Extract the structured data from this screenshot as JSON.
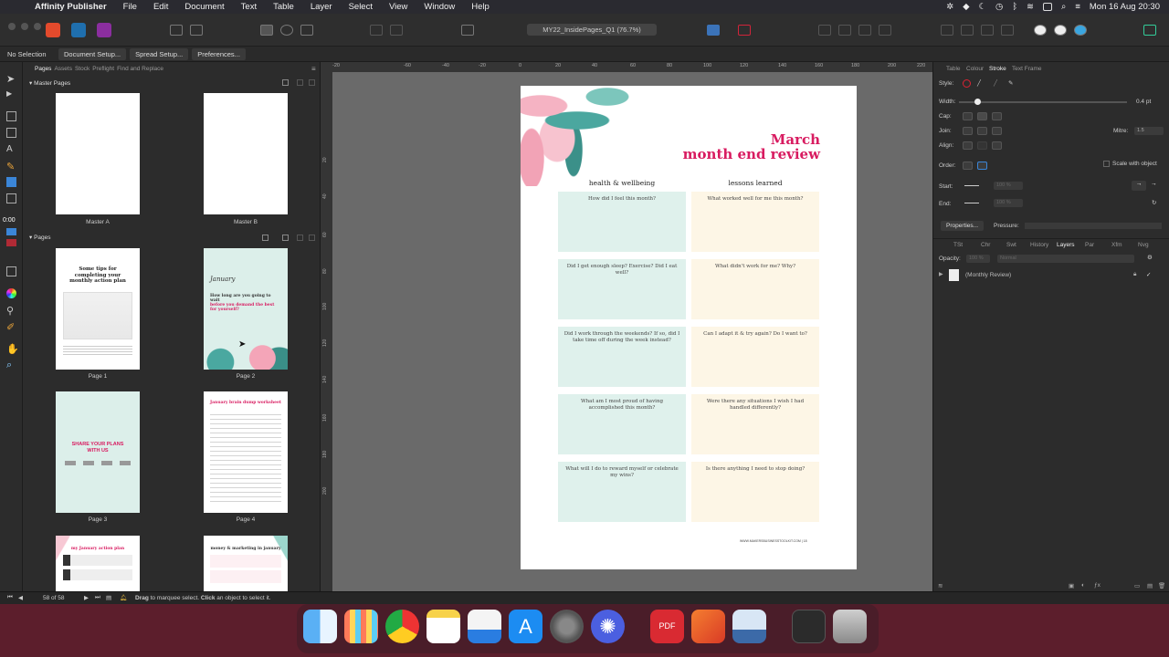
{
  "menubar": {
    "app_name": "Affinity Publisher",
    "items": [
      "File",
      "Edit",
      "Document",
      "Text",
      "Table",
      "Layer",
      "Select",
      "View",
      "Window",
      "Help"
    ],
    "clock": "Mon 16 Aug  20:30"
  },
  "toolbar": {
    "document_name": "MY22_InsidePages_Q1 (76.7%)"
  },
  "contextbar": {
    "selection": "No Selection",
    "document_setup": "Document Setup...",
    "spread_setup": "Spread Setup...",
    "preferences": "Preferences..."
  },
  "tools": {
    "timer": "0:00"
  },
  "pages_panel": {
    "tabs": [
      "Pages",
      "Assets",
      "Stock",
      "Preflight",
      "Find and Replace"
    ],
    "master_header": "Master Pages",
    "pages_header": "Pages",
    "masters": [
      "Master A",
      "Master B"
    ],
    "pages": [
      {
        "label": "Page 1",
        "title": "Some tips for completing your monthly action plan"
      },
      {
        "label": "Page 2",
        "script": "January",
        "question": "How long are you going to wait",
        "question_pink": "before you demand the best for yourself?"
      },
      {
        "label": "Page 3",
        "title": "SHARE YOUR PLANS WITH US"
      },
      {
        "label": "Page 4",
        "title": "January brain dump worksheet"
      },
      {
        "label": "",
        "title": "my January action plan"
      },
      {
        "label": "",
        "title": "money & marketing in january"
      }
    ]
  },
  "ruler": {
    "top": [
      "-20",
      "-40",
      "-60",
      "-40",
      "-20",
      "0",
      "20",
      "40",
      "60",
      "80",
      "100",
      "120",
      "140",
      "160",
      "180",
      "200",
      "220"
    ],
    "left": [
      "20",
      "40",
      "60",
      "80",
      "100",
      "120",
      "140",
      "160",
      "180",
      "200"
    ]
  },
  "page": {
    "title_line1": "March",
    "title_line2": "month end review",
    "col_left": "health & wellbeing",
    "col_right": "lessons learned",
    "left_boxes": [
      "How did I feel this month?",
      "Did I get enough sleep? Exercise? Did I eat well?",
      "Did I work through the weekends? If so, did I take time off during the week instead?",
      "What am I most proud of having accomplished this month?",
      "What will I do to reward myself or celebrate my wins?"
    ],
    "right_boxes": [
      "What worked well for me this month?",
      "What didn't work for me? Why?",
      "Can I adapt it & try again? Do I want to?",
      "Were there any situations I wish I had handled differently?",
      "Is there anything I need to stop doing?"
    ],
    "footer": "WWW.MAKERSBUSINESSTOOLKIT.COM | 18"
  },
  "right_panel": {
    "top_tabs": [
      "Table",
      "Colour",
      "Stroke",
      "Text Frame"
    ],
    "style_label": "Style:",
    "width_label": "Width:",
    "width_value": "0.4 pt",
    "cap_label": "Cap:",
    "join_label": "Join:",
    "align_label": "Align:",
    "mitre_label": "Mitre:",
    "mitre_value": "1.5",
    "order_label": "Order:",
    "scale_label": "Scale with object",
    "start_label": "Start:",
    "end_label": "End:",
    "start_pct": "100 %",
    "end_pct": "100 %",
    "properties_button": "Properties...",
    "pressure_label": "Pressure:",
    "lower_tabs": [
      "TSt",
      "Chr",
      "Swt",
      "History",
      "Layers",
      "Par",
      "Xfm",
      "Nvg"
    ],
    "opacity_label": "Opacity:",
    "opacity_value": "100 %",
    "blend_mode": "Normal",
    "layer_name": "(Monthly Review)"
  },
  "statusbar": {
    "page_count": "58 of 58",
    "hint_drag": "Drag",
    "hint_mid": " to marquee select. ",
    "hint_click": "Click",
    "hint_end": " an object to select it."
  },
  "dock": {
    "apps": [
      "Finder",
      "Launchpad",
      "Chrome",
      "Notes",
      "Keynote",
      "App Store",
      "System Preferences",
      "Affinity Extension",
      "PDF Expert",
      "Affinity Publisher",
      "Preview",
      "Screenshot",
      "Trash"
    ]
  }
}
